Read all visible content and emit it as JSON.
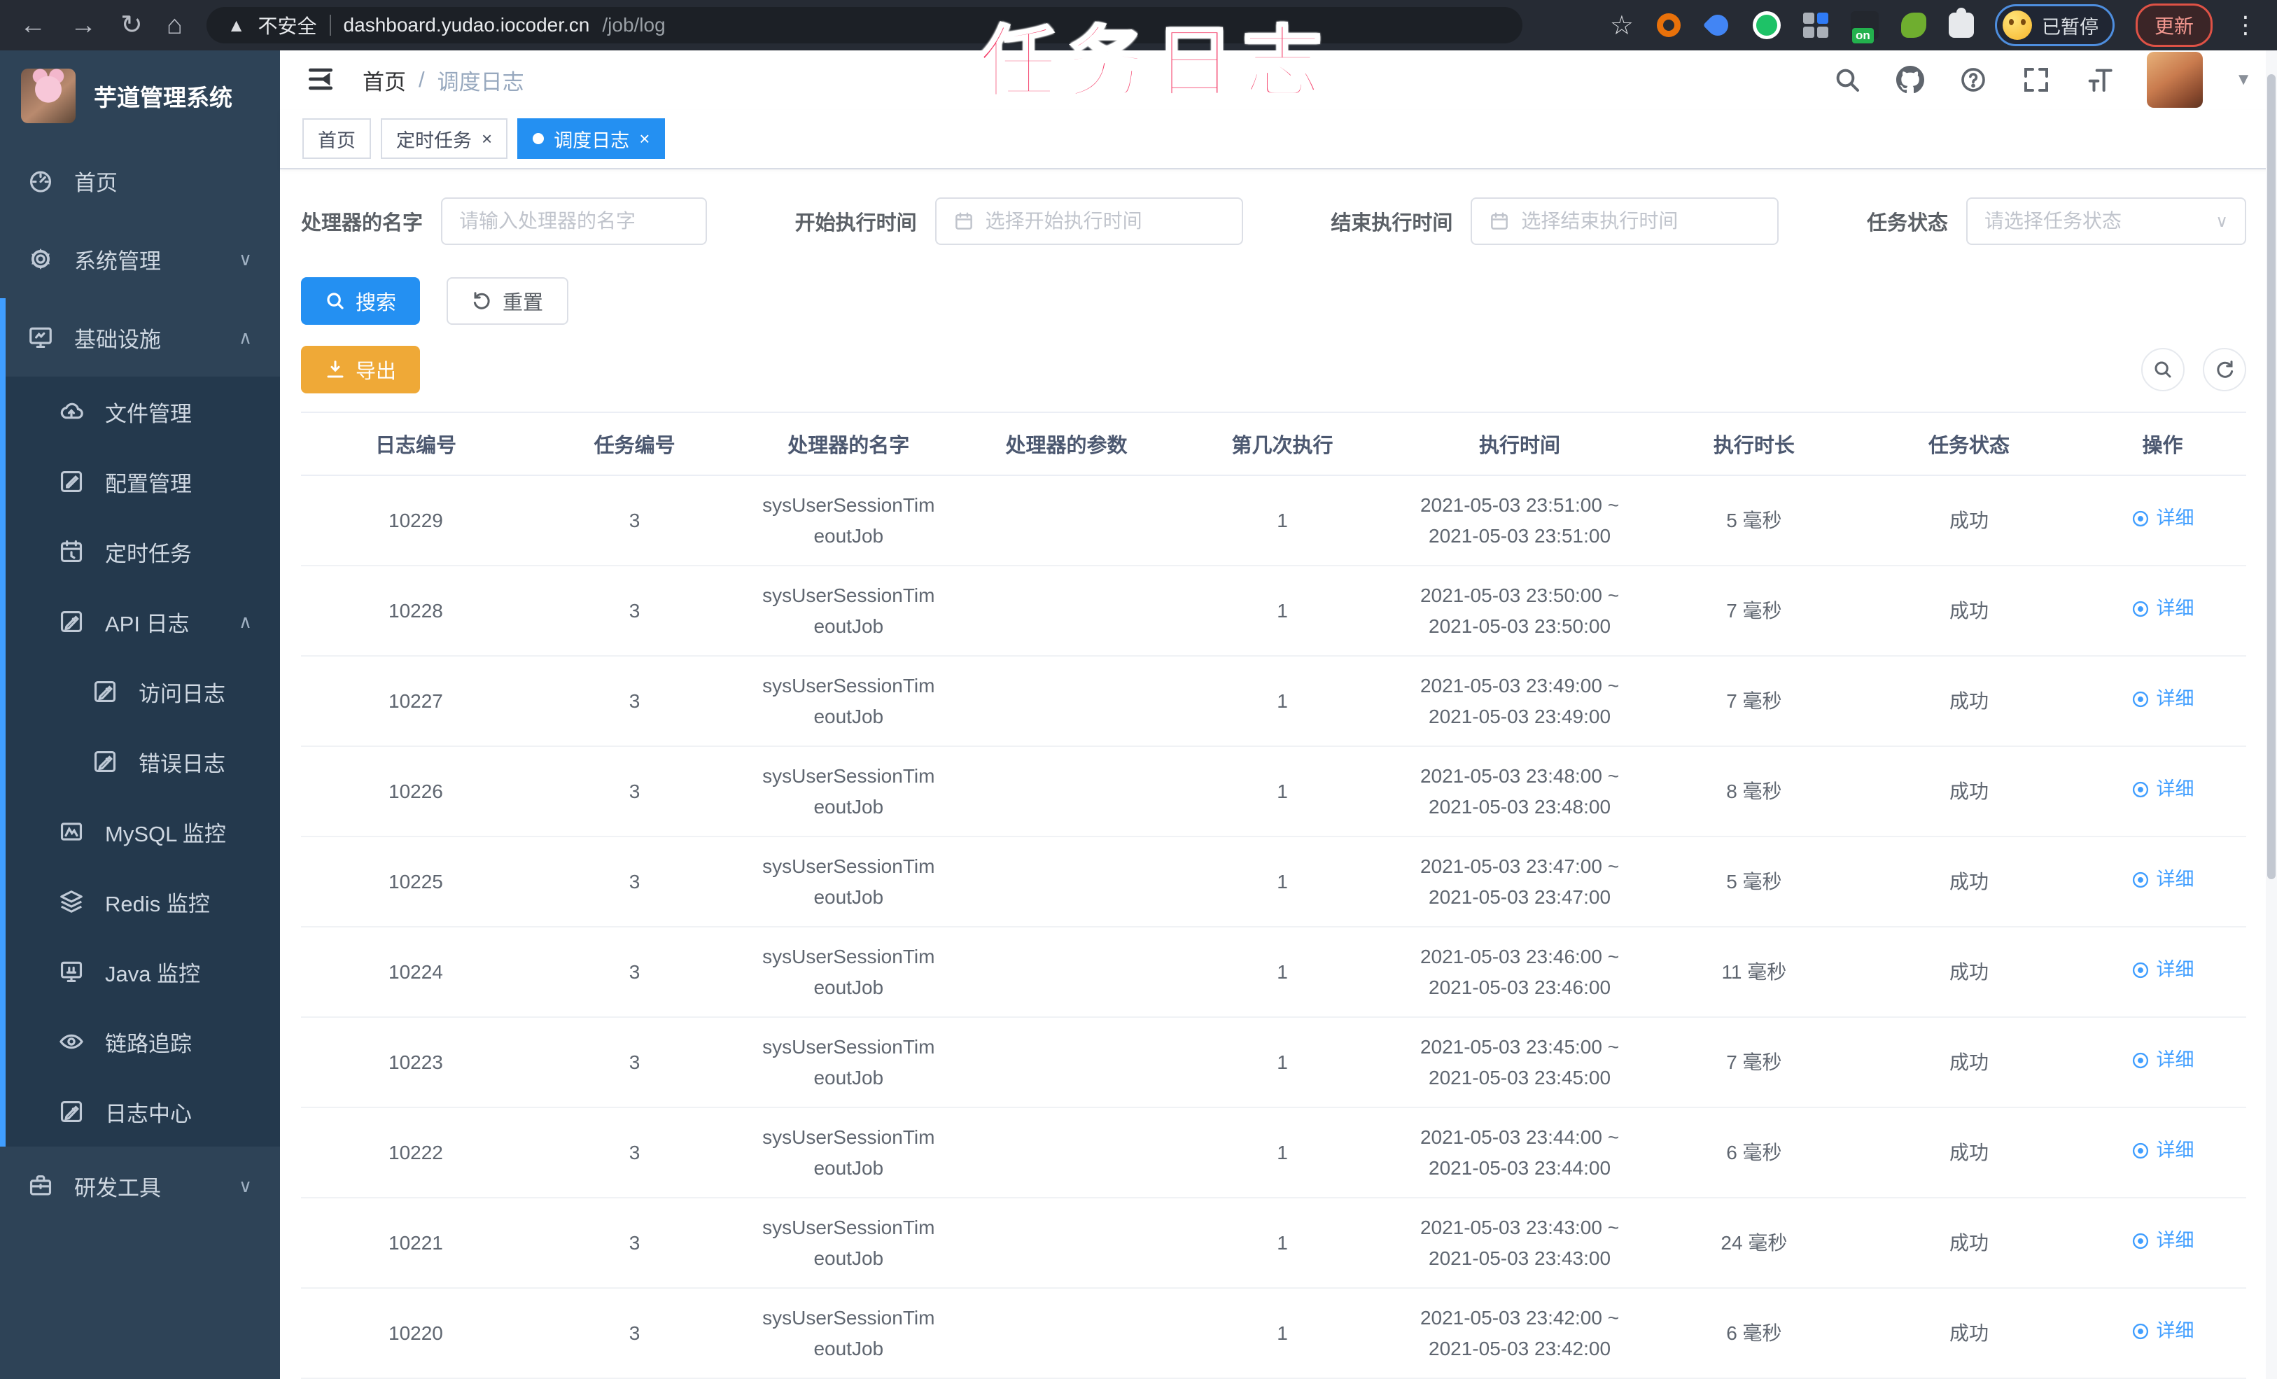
{
  "watermark": "任务日志",
  "colors": {
    "primary": "#409eff",
    "tab_active": "#2490f2",
    "warning": "#efa937",
    "watermark_pink": "#f4416b",
    "sidebar_bg": "#2e4357",
    "submenu_bg": "#24394d"
  },
  "browser": {
    "security_label": "不安全",
    "url_host": "dashboard.yudao.iocoder.cn",
    "url_path": "/job/log",
    "paused_label": "已暂停",
    "update_label": "更新"
  },
  "sidebar": {
    "app_title": "芋道管理系统",
    "items": [
      {
        "label": "首页",
        "icon": "dashboard-icon"
      },
      {
        "label": "系统管理",
        "icon": "gear-icon",
        "chevron": "down"
      },
      {
        "label": "基础设施",
        "icon": "infra-icon",
        "chevron": "up",
        "expanded": true,
        "children": [
          {
            "label": "文件管理",
            "icon": "cloud-upload-icon"
          },
          {
            "label": "配置管理",
            "icon": "edit-icon"
          },
          {
            "label": "定时任务",
            "icon": "timer-icon"
          },
          {
            "label": "API 日志",
            "icon": "log-edit-icon",
            "chevron": "up",
            "expanded": false,
            "children": [
              {
                "label": "访问日志",
                "icon": "log-edit-icon"
              },
              {
                "label": "错误日志",
                "icon": "log-edit-icon"
              }
            ]
          },
          {
            "label": "MySQL 监控",
            "icon": "mysql-icon"
          },
          {
            "label": "Redis 监控",
            "icon": "redis-icon"
          },
          {
            "label": "Java 监控",
            "icon": "java-icon"
          },
          {
            "label": "链路追踪",
            "icon": "eye-icon"
          },
          {
            "label": "日志中心",
            "icon": "log-edit-icon"
          }
        ]
      },
      {
        "label": "研发工具",
        "icon": "toolbox-icon",
        "chevron": "down"
      }
    ]
  },
  "header": {
    "breadcrumb": [
      "首页",
      "调度日志"
    ],
    "breadcrumb_separator": "/"
  },
  "tabs": [
    {
      "label": "首页",
      "closable": false,
      "active": false
    },
    {
      "label": "定时任务",
      "closable": true,
      "active": false
    },
    {
      "label": "调度日志",
      "closable": true,
      "active": true
    }
  ],
  "filters": [
    {
      "label": "处理器的名字",
      "placeholder": "请输入处理器的名字",
      "type": "text"
    },
    {
      "label": "开始执行时间",
      "placeholder": "选择开始执行时间",
      "type": "date"
    },
    {
      "label": "结束执行时间",
      "placeholder": "选择结束执行时间",
      "type": "date"
    },
    {
      "label": "任务状态",
      "placeholder": "请选择任务状态",
      "type": "select"
    }
  ],
  "actions": {
    "search": "搜索",
    "reset": "重置",
    "export": "导出"
  },
  "table": {
    "columns": [
      "日志编号",
      "任务编号",
      "处理器的名字",
      "处理器的参数",
      "第几次执行",
      "执行时间",
      "执行时长",
      "任务状态",
      "操作"
    ],
    "rows": [
      {
        "log_id": "10229",
        "job_id": "3",
        "handler": [
          "sysUserSessionTim",
          "eoutJob"
        ],
        "param": "",
        "count": "1",
        "time": [
          "2021-05-03 23:51:00 ~",
          "2021-05-03 23:51:00"
        ],
        "duration": "5 毫秒",
        "status": "成功",
        "action": "详细"
      },
      {
        "log_id": "10228",
        "job_id": "3",
        "handler": [
          "sysUserSessionTim",
          "eoutJob"
        ],
        "param": "",
        "count": "1",
        "time": [
          "2021-05-03 23:50:00 ~",
          "2021-05-03 23:50:00"
        ],
        "duration": "7 毫秒",
        "status": "成功",
        "action": "详细"
      },
      {
        "log_id": "10227",
        "job_id": "3",
        "handler": [
          "sysUserSessionTim",
          "eoutJob"
        ],
        "param": "",
        "count": "1",
        "time": [
          "2021-05-03 23:49:00 ~",
          "2021-05-03 23:49:00"
        ],
        "duration": "7 毫秒",
        "status": "成功",
        "action": "详细"
      },
      {
        "log_id": "10226",
        "job_id": "3",
        "handler": [
          "sysUserSessionTim",
          "eoutJob"
        ],
        "param": "",
        "count": "1",
        "time": [
          "2021-05-03 23:48:00 ~",
          "2021-05-03 23:48:00"
        ],
        "duration": "8 毫秒",
        "status": "成功",
        "action": "详细"
      },
      {
        "log_id": "10225",
        "job_id": "3",
        "handler": [
          "sysUserSessionTim",
          "eoutJob"
        ],
        "param": "",
        "count": "1",
        "time": [
          "2021-05-03 23:47:00 ~",
          "2021-05-03 23:47:00"
        ],
        "duration": "5 毫秒",
        "status": "成功",
        "action": "详细"
      },
      {
        "log_id": "10224",
        "job_id": "3",
        "handler": [
          "sysUserSessionTim",
          "eoutJob"
        ],
        "param": "",
        "count": "1",
        "time": [
          "2021-05-03 23:46:00 ~",
          "2021-05-03 23:46:00"
        ],
        "duration": "11 毫秒",
        "status": "成功",
        "action": "详细"
      },
      {
        "log_id": "10223",
        "job_id": "3",
        "handler": [
          "sysUserSessionTim",
          "eoutJob"
        ],
        "param": "",
        "count": "1",
        "time": [
          "2021-05-03 23:45:00 ~",
          "2021-05-03 23:45:00"
        ],
        "duration": "7 毫秒",
        "status": "成功",
        "action": "详细"
      },
      {
        "log_id": "10222",
        "job_id": "3",
        "handler": [
          "sysUserSessionTim",
          "eoutJob"
        ],
        "param": "",
        "count": "1",
        "time": [
          "2021-05-03 23:44:00 ~",
          "2021-05-03 23:44:00"
        ],
        "duration": "6 毫秒",
        "status": "成功",
        "action": "详细"
      },
      {
        "log_id": "10221",
        "job_id": "3",
        "handler": [
          "sysUserSessionTim",
          "eoutJob"
        ],
        "param": "",
        "count": "1",
        "time": [
          "2021-05-03 23:43:00 ~",
          "2021-05-03 23:43:00"
        ],
        "duration": "24 毫秒",
        "status": "成功",
        "action": "详细"
      },
      {
        "log_id": "10220",
        "job_id": "3",
        "handler": [
          "sysUserSessionTim",
          "eoutJob"
        ],
        "param": "",
        "count": "1",
        "time": [
          "2021-05-03 23:42:00 ~",
          "2021-05-03 23:42:00"
        ],
        "duration": "6 毫秒",
        "status": "成功",
        "action": "详细"
      }
    ],
    "column_widths": [
      "11.8%",
      "10.7%",
      "11.3%",
      "11.1%",
      "11.1%",
      "13.3%",
      "10.8%",
      "11.3%",
      "8.6%"
    ]
  }
}
